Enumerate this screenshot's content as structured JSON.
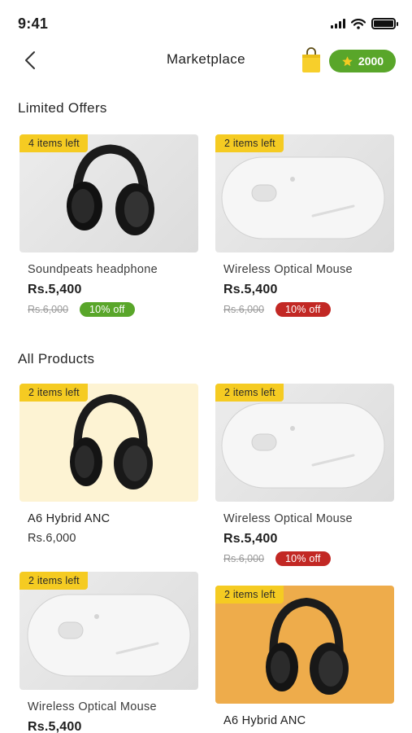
{
  "status_bar": {
    "time": "9:41"
  },
  "header": {
    "title": "Marketplace",
    "coins": "2000"
  },
  "sections": {
    "limited_offers": {
      "title": "Limited Offers",
      "items": [
        {
          "badge": "4 items left",
          "name": "Soundpeats headphone",
          "price": "Rs.5,400",
          "old_price": "Rs.6,000",
          "discount": "10% off",
          "discount_color": "#59a62a",
          "image": "headphone"
        },
        {
          "badge": "2 items left",
          "name": "Wireless Optical Mouse",
          "price": "Rs.5,400",
          "old_price": "Rs.6,000",
          "discount": "10% off",
          "discount_color": "#c22824",
          "image": "mouse"
        }
      ]
    },
    "all_products": {
      "title": "All Products",
      "items": [
        {
          "badge": "2 items left",
          "name": "A6 Hybrid ANC",
          "price": "Rs.6,000",
          "image": "headphone"
        },
        {
          "badge": "2 items left",
          "name": "Wireless Optical Mouse",
          "price": "Rs.5,400",
          "old_price": "Rs.6,000",
          "discount": "10% off",
          "discount_color": "#c22824",
          "image": "mouse"
        },
        {
          "badge": "2 items left",
          "name": "Wireless Optical Mouse",
          "price": "Rs.5,400",
          "image": "mouse"
        },
        {
          "badge": "2 items left",
          "name": "A6 Hybrid ANC",
          "image": "headphone"
        }
      ]
    }
  },
  "colors": {
    "accent_green": "#59a62a",
    "discount_red": "#c22824",
    "badge_yellow": "#f5cb22",
    "bag_yellow": "#f7cf2b"
  }
}
